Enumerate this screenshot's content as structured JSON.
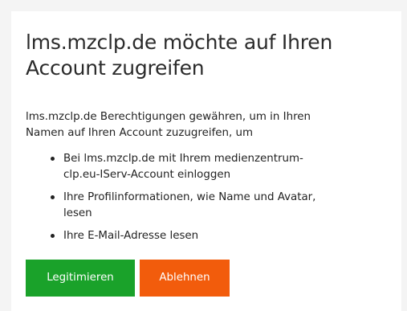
{
  "dialog": {
    "title_line1": "lms.mzclp.de möchte auf Ihren",
    "title_line2": "Account zugreifen",
    "intro_line1": "lms.mzclp.de Berechtigungen gewähren, um in Ihren",
    "intro_line2": "Namen auf Ihren Account zuzugreifen, um",
    "scopes": [
      {
        "line1": "Bei lms.mzclp.de mit Ihrem medienzentrum-",
        "line2": "clp.eu-IServ-Account einloggen"
      },
      {
        "line1": "Ihre Profilinformationen, wie Name und Avatar,",
        "line2": "lesen"
      },
      {
        "line1": "Ihre E-Mail-Adresse lesen",
        "line2": ""
      }
    ]
  },
  "actions": {
    "accept_label": "Legitimieren",
    "deny_label": "Ablehnen"
  },
  "colors": {
    "accept": "#1aa22a",
    "deny": "#f25c0c",
    "page_background": "#f4f4f4",
    "card_background": "#ffffff"
  }
}
